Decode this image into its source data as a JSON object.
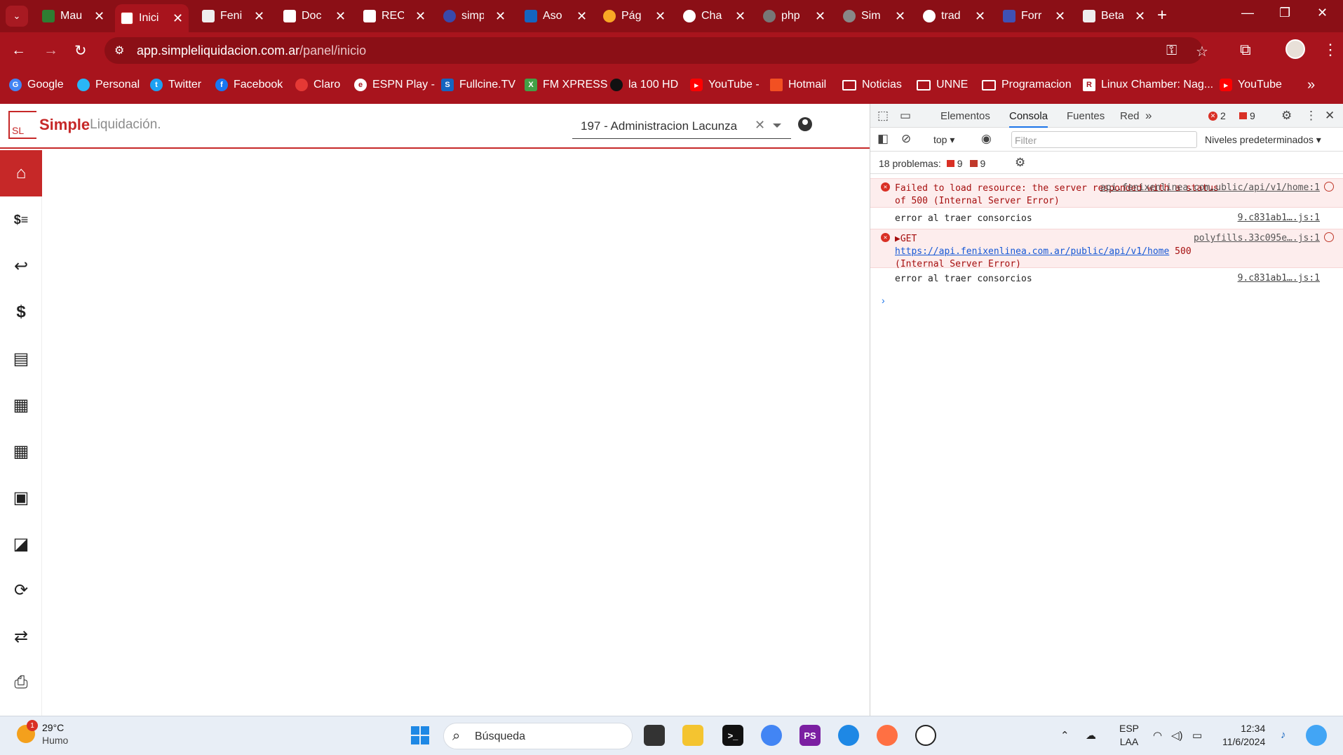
{
  "browser": {
    "tabs": [
      {
        "title": "Mau",
        "color": "#2e7d32"
      },
      {
        "title": "Inici",
        "color": "#c62828",
        "active": true
      },
      {
        "title": "Feni",
        "color": "#555555"
      },
      {
        "title": "Doc",
        "color": "#1e88e5"
      },
      {
        "title": "REC",
        "color": "#d32f2f"
      },
      {
        "title": "simp",
        "color": "#3949ab"
      },
      {
        "title": "Aso",
        "color": "#1565c0"
      },
      {
        "title": "Pág",
        "color": "#f9a825"
      },
      {
        "title": "Cha",
        "color": "#202124"
      },
      {
        "title": "php",
        "color": "#777777"
      },
      {
        "title": "Sim",
        "color": "#888888"
      },
      {
        "title": "trad",
        "color": "#4285f4"
      },
      {
        "title": "Forr",
        "color": "#3f51b5"
      },
      {
        "title": "Beta",
        "color": "#eeeeee"
      }
    ],
    "address": {
      "domain": "app.simpleliquidacion.com.ar",
      "path": "/panel/inicio"
    },
    "bookmarks": [
      {
        "label": "Google",
        "color": "#4285f4"
      },
      {
        "label": "Personal",
        "color": "#29b6f6"
      },
      {
        "label": "Twitter",
        "color": "#1da1f2"
      },
      {
        "label": "Facebook",
        "color": "#1877f2"
      },
      {
        "label": "Claro",
        "color": "#e53935"
      },
      {
        "label": "ESPN Play -",
        "color": "#ffffff"
      },
      {
        "label": "Fullcine.TV",
        "color": "#1565c0"
      },
      {
        "label": "FM XPRESS",
        "color": "#43a047"
      },
      {
        "label": "la 100 HD",
        "color": "#111111"
      },
      {
        "label": "YouTube -",
        "color": "#ff0000"
      },
      {
        "label": "Hotmail",
        "color": "#f25022"
      },
      {
        "label": "Noticias",
        "folder": true
      },
      {
        "label": "UNNE",
        "folder": true
      },
      {
        "label": "Programacion",
        "folder": true
      },
      {
        "label": "Linux Chamber: Nag...",
        "color": "#ffffff"
      },
      {
        "label": "YouTube",
        "color": "#ff0000"
      }
    ]
  },
  "app": {
    "logo_bold": "Simple",
    "logo_light": "Liquidación.",
    "logo_mark": "SL",
    "selected_consorcio": "197 - Administracion Lacunza",
    "sidebar_icons": [
      "home-icon",
      "cash-icon",
      "reply-all-icon",
      "dollar-icon",
      "document-icon",
      "calendar-check-icon",
      "table-icon",
      "badge-icon",
      "note-icon",
      "sync-icon",
      "exchange-icon",
      "print-icon"
    ]
  },
  "devtools": {
    "tabs": [
      "Elementos",
      "Consola",
      "Fuentes",
      "Red"
    ],
    "active_tab": "Consola",
    "error_count": "2",
    "issue_count": "9",
    "context": "top",
    "filter_placeholder": "Filter",
    "levels": "Niveles predeterminados",
    "problems_label": "18 problemas:",
    "problems_errors": "9",
    "problems_info": "9",
    "logs": [
      {
        "type": "error",
        "message": "Failed to load resource: the server responded with a status of 500 (Internal Server Error)",
        "source": "api.fenixenlinea.com…ublic/api/v1/home:1"
      },
      {
        "type": "log",
        "message": "error al traer consorcios",
        "source": "9.c831ab1….js:1"
      },
      {
        "type": "error",
        "prefix": "▶GET",
        "url": "https://api.fenixenlinea.com.ar/public/api/v1/home",
        "suffix": "500 (Internal Server Error)",
        "source": "polyfills.33c095e….js:1"
      },
      {
        "type": "log",
        "message": "error al traer consorcios",
        "source": "9.c831ab1….js:1"
      }
    ]
  },
  "taskbar": {
    "temperature": "29°C",
    "weather": "Humo",
    "weather_badge": "1",
    "search_placeholder": "Búsqueda",
    "lang_top": "ESP",
    "lang_bottom": "LAA",
    "time": "12:34",
    "date": "11/6/2024"
  }
}
